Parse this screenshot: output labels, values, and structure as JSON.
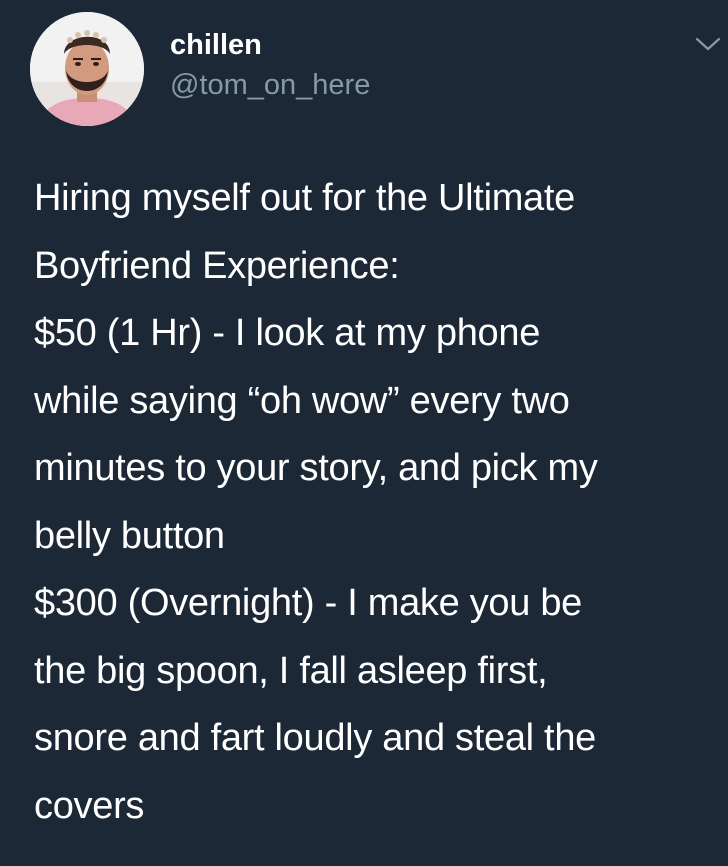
{
  "author": {
    "display_name": "chillen",
    "handle": "@tom_on_here",
    "avatar_icon": "profile-photo"
  },
  "menu": {
    "icon": "chevron-down-icon"
  },
  "tweet": {
    "lines": [
      "Hiring myself out for the Ultimate",
      "Boyfriend Experience:",
      "$50 (1 Hr) - I look at my phone",
      "while saying “oh wow” every two",
      "minutes to your story, and pick my",
      "belly button",
      "$300 (Overnight) - I make you be",
      "the big spoon, I fall asleep first,",
      "snore and fart loudly and steal the",
      "covers"
    ]
  },
  "colors": {
    "background": "#1c2836",
    "text": "#ffffff",
    "secondary": "#8899a6"
  }
}
